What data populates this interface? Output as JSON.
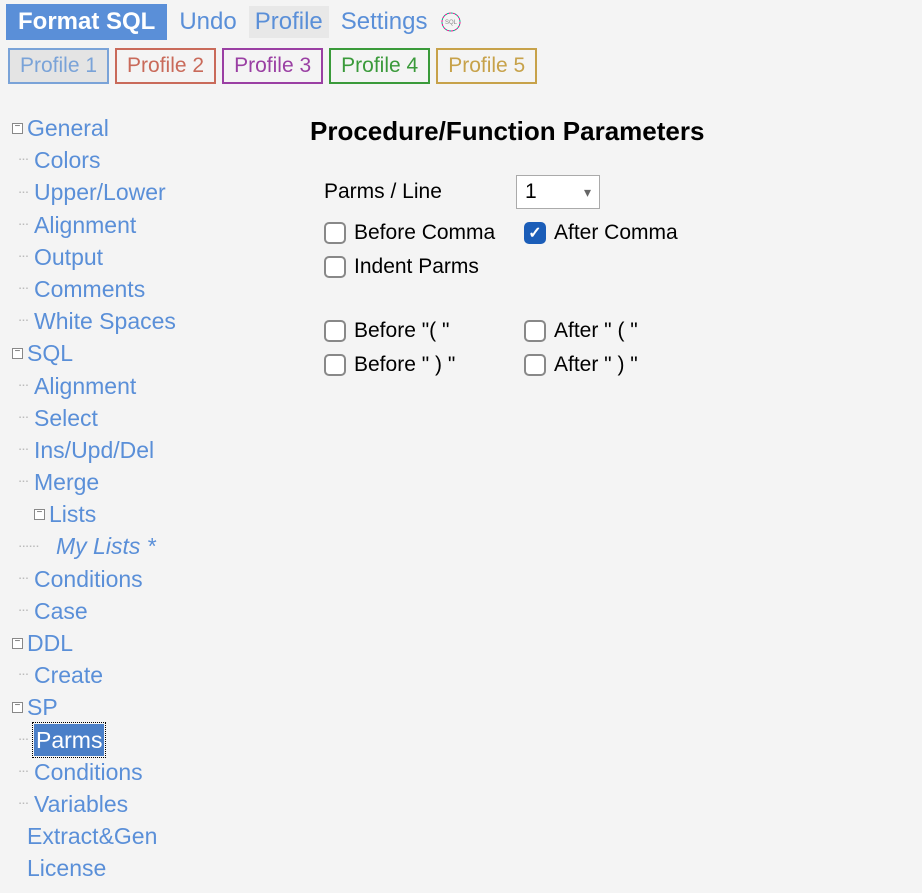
{
  "toolbar": {
    "format": "Format SQL",
    "undo": "Undo",
    "profile": "Profile",
    "settings": "Settings"
  },
  "profiles": [
    {
      "label": "Profile 1",
      "color": "#7aa3d8",
      "bg": "#e4e4e4"
    },
    {
      "label": "Profile 2",
      "color": "#c96a5a",
      "bg": "#f4f4f4"
    },
    {
      "label": "Profile 3",
      "color": "#9a3fa3",
      "bg": "#f4f4f4"
    },
    {
      "label": "Profile 4",
      "color": "#3a9a3a",
      "bg": "#f4f4f4"
    },
    {
      "label": "Profile 5",
      "color": "#c7a24a",
      "bg": "#f4f4f4"
    }
  ],
  "tree": {
    "general": {
      "label": "General",
      "children": [
        "Colors",
        "Upper/Lower",
        "Alignment",
        "Output",
        "Comments",
        "White Spaces"
      ]
    },
    "sql": {
      "label": "SQL",
      "children_before": [
        "Alignment",
        "Select",
        "Ins/Upd/Del",
        "Merge"
      ],
      "lists": {
        "label": "Lists",
        "child": "My Lists *"
      },
      "children_after": [
        "Conditions",
        "Case"
      ]
    },
    "ddl": {
      "label": "DDL",
      "children": [
        "Create"
      ]
    },
    "sp": {
      "label": "SP",
      "children": [
        "Parms",
        "Conditions",
        "Variables"
      ],
      "selected": "Parms"
    },
    "extract": "Extract&Gen",
    "license": "License"
  },
  "content": {
    "heading": "Procedure/Function Parameters",
    "parms_line_label": "Parms / Line",
    "parms_line_value": "1",
    "before_comma": "Before Comma",
    "after_comma": "After Comma",
    "indent_parms": "Indent Parms",
    "before_open": "Before \"( \"",
    "after_open": "After \" ( \"",
    "before_close": "Before \" ) \"",
    "after_close": "After \" ) \"",
    "checked": {
      "after_comma": true
    }
  }
}
